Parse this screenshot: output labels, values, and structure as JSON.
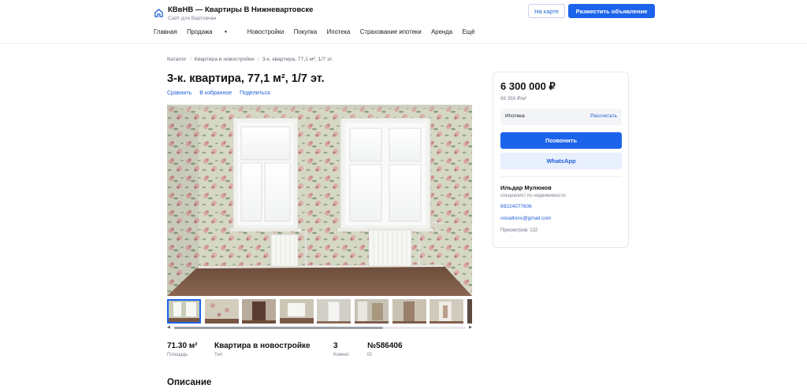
{
  "header": {
    "title": "КВвНВ — Квартиры В Нижневартовске",
    "subtitle": "Сайт для Вартовчан",
    "map_button": "На карте",
    "post_button": "Разместить объявление"
  },
  "nav": {
    "items": [
      {
        "label": "Главная"
      },
      {
        "label": "Продажа",
        "has_dropdown": true
      },
      {
        "label": "Новостройки"
      },
      {
        "label": "Покупка"
      },
      {
        "label": "Ипотека"
      },
      {
        "label": "Страхование ипотеки"
      },
      {
        "label": "Аренда"
      },
      {
        "label": "Ещё"
      }
    ]
  },
  "breadcrumb": [
    "Каталог",
    "Квартира в новостройке",
    "3-к. квартира, 77,1 м², 1/7 эт."
  ],
  "listing": {
    "title": "3-к. квартира, 77,1 м², 1/7 эт.",
    "actions": [
      "Сравнить",
      "В избранное",
      "Поделиться"
    ],
    "gallery": {
      "main_image": "room-with-two-windows-and-floral-wallpaper",
      "thumbnails": [
        "room-two-windows",
        "floral-wallpaper-wall",
        "doorway-dark",
        "room-window",
        "white-door",
        "hallway-mirror",
        "doorway-hall",
        "corridor-door",
        "room-partial"
      ],
      "active_index": 0
    },
    "facts": [
      {
        "value": "71.30 м²",
        "label": "Площадь"
      },
      {
        "value": "Квартира в новостройке",
        "label": "Тип"
      },
      {
        "value": "3",
        "label": "Комнат"
      },
      {
        "value": "№586406",
        "label": "ID"
      }
    ],
    "description_title": "Описание"
  },
  "sidebar": {
    "price": "6 300 000 ₽",
    "price_per_m2": "88 359 ₽/м²",
    "mortgage_label": "Ипотека",
    "mortgage_link": "Рассчитать",
    "call_button": "Позвонить",
    "whatsapp_button": "WhatsApp",
    "agent_name": "Ильдар Мулюков",
    "agent_role": "специалист по недвижимости",
    "phone": "89224077606",
    "email": "oooaltonv@gmail.com",
    "views": "Просмотров: 122"
  },
  "colors": {
    "accent": "#1c63eb",
    "link": "#1f5fd6",
    "muted": "#7b8190"
  }
}
